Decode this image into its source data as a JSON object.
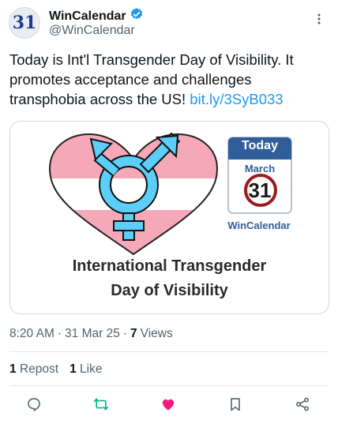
{
  "author": {
    "avatar_text": "31",
    "display_name": "WinCalendar",
    "handle": "@WinCalendar",
    "verified_icon": "verified-badge-icon"
  },
  "tweet": {
    "text": "Today is Int'l Transgender Day of Visibility. It promotes acceptance and challenges transphobia across the US! ",
    "link": "bit.ly/3SyB033"
  },
  "media": {
    "title_line1": "International Transgender",
    "title_line2": "Day of Visibility",
    "calendar_today": "Today",
    "calendar_month": "March",
    "calendar_day": "31",
    "calendar_brand": "WinCalendar",
    "flag_colors": {
      "blue": "#5bcefa",
      "pink": "#f5a9b8",
      "white": "#ffffff"
    }
  },
  "meta": {
    "time": "8:20 AM",
    "sep1": "·",
    "date": "31 Mar 25",
    "sep2": "·",
    "views_count": "7",
    "views_label": "Views"
  },
  "stats": {
    "reposts_count": "1",
    "reposts_label": "Repost",
    "likes_count": "1",
    "likes_label": "Like"
  },
  "colors": {
    "accent": "#1d9bf0",
    "repost_green": "#00ba7c",
    "like_pink": "#f91880",
    "secondary_text": "#536471"
  }
}
